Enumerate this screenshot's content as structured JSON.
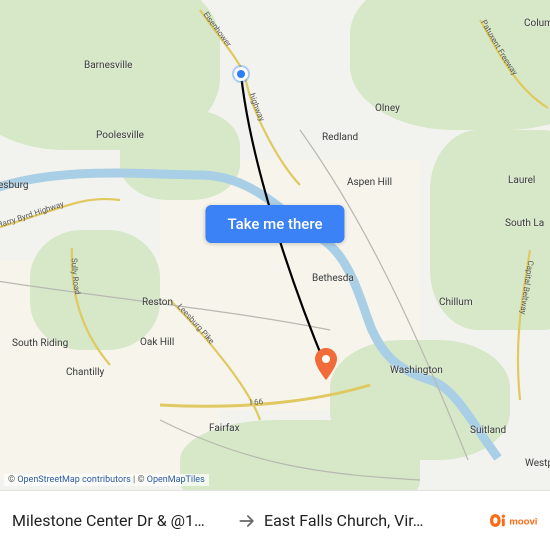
{
  "map": {
    "attribution": {
      "prefix": "© ",
      "osm": "OpenStreetMap contributors",
      "sep": " | © ",
      "omt": "OpenMapTiles"
    },
    "cta_label": "Take me there",
    "cities": [
      {
        "key": "barnesville",
        "text": "Barnesville"
      },
      {
        "key": "poolesville",
        "text": "Poolesville"
      },
      {
        "key": "olney",
        "text": "Olney"
      },
      {
        "key": "redland",
        "text": "Redland"
      },
      {
        "key": "aspenhill",
        "text": "Aspen Hill"
      },
      {
        "key": "laurel",
        "text": "Laurel"
      },
      {
        "key": "southla",
        "text": "South La"
      },
      {
        "key": "esburg",
        "text": "esburg"
      },
      {
        "key": "southriding",
        "text": "South Riding"
      },
      {
        "key": "chantilly",
        "text": "Chantilly"
      },
      {
        "key": "oakhill",
        "text": "Oak Hill"
      },
      {
        "key": "reston",
        "text": "Reston"
      },
      {
        "key": "bethesda",
        "text": "Bethesda"
      },
      {
        "key": "chillum",
        "text": "Chillum"
      },
      {
        "key": "washington",
        "text": "Washington"
      },
      {
        "key": "fairfax",
        "text": "Fairfax"
      },
      {
        "key": "suitland",
        "text": "Suitland"
      },
      {
        "key": "westp",
        "text": "Westp"
      },
      {
        "key": "colum",
        "text": "Colum"
      }
    ],
    "roads": [
      {
        "key": "eisenhower",
        "label": "Eisenhower"
      },
      {
        "key": "hwy_north",
        "label": "highway"
      },
      {
        "key": "harry_byrd",
        "label": "Harry Byrd Highway"
      },
      {
        "key": "sully",
        "label": "Sully Road"
      },
      {
        "key": "leesburg",
        "label": "Leesburg Pike"
      },
      {
        "key": "i66",
        "label": "I 66"
      },
      {
        "key": "patuxent",
        "label": "Patuxent Freeway"
      },
      {
        "key": "capbeltway",
        "label": "Capital Beltway"
      }
    ],
    "origin_label": "origin-marker",
    "dest_label": "destination-marker"
  },
  "bar": {
    "from": "Milestone Center Dr & @1…",
    "to": "East Falls Church, Vir…",
    "logo_alt": "moovit"
  },
  "icons": {
    "arrow": "arrow-right-icon"
  },
  "colors": {
    "accent": "#3b82f6",
    "origin": "#2d7ff9",
    "dest": "#f26b3a"
  }
}
